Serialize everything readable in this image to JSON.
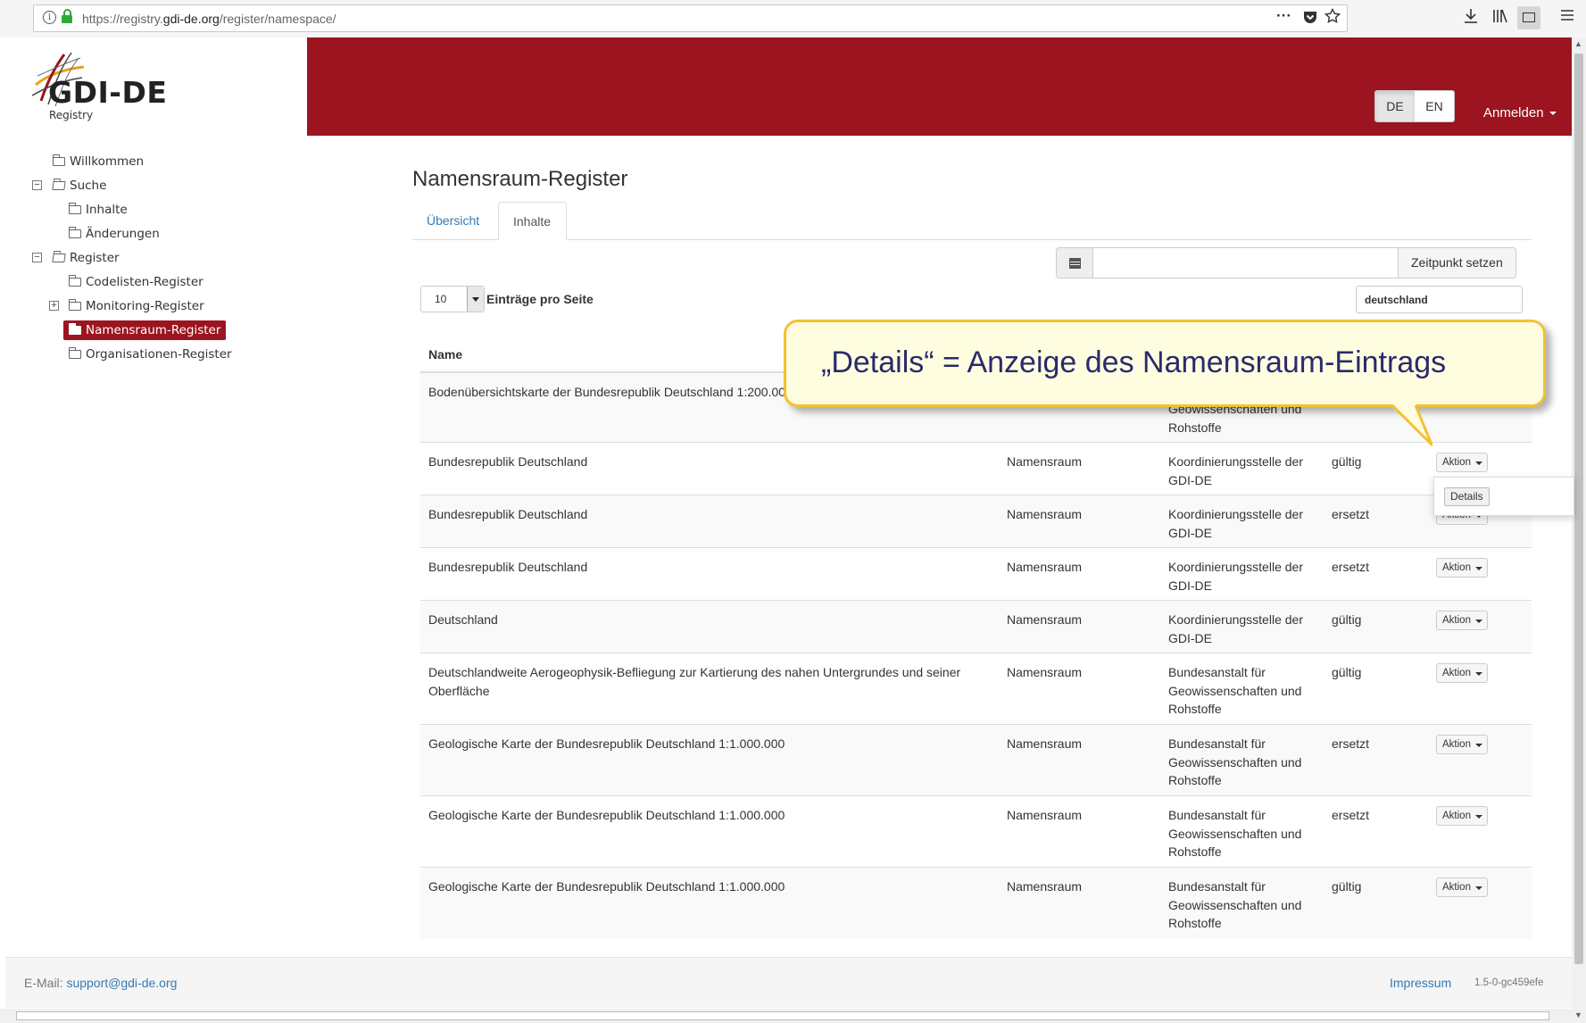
{
  "browser": {
    "url_prefix": "https://registry.",
    "url_domain": "gdi-de.org",
    "url_path": "/register/namespace/",
    "dots": "···"
  },
  "logo": {
    "text": "GDI-DE",
    "sub": "Registry"
  },
  "header": {
    "lang_de": "DE",
    "lang_en": "EN",
    "login": "Anmelden"
  },
  "nav": [
    {
      "label": "Willkommen"
    },
    {
      "label": "Suche"
    },
    {
      "label": "Inhalte"
    },
    {
      "label": "Änderungen"
    },
    {
      "label": "Register"
    },
    {
      "label": "Codelisten-Register"
    },
    {
      "label": "Monitoring-Register"
    },
    {
      "label": "Namensraum-Register"
    },
    {
      "label": "Organisationen-Register"
    }
  ],
  "main": {
    "title": "Namensraum-Register",
    "tabs": [
      "Übersicht",
      "Inhalte"
    ],
    "set_time_label": "Zeitpunkt setzen",
    "page_length": "10",
    "page_length_label": "Einträge pro Seite",
    "search_value": "deutschland",
    "col_name": "Name"
  },
  "rows": [
    {
      "name": "Bodenübersichtskarte der Bundesrepublik Deutschland 1:200.000",
      "type": "",
      "owner": "Geowissenschaften und Rohstoffe",
      "status": "",
      "action": ""
    },
    {
      "name": "Bundesrepublik Deutschland",
      "type": "Namensraum",
      "owner": "Koordinierungsstelle der GDI-DE",
      "status": "gültig",
      "action": "Aktion"
    },
    {
      "name": "Bundesrepublik Deutschland",
      "type": "Namensraum",
      "owner": "Koordinierungsstelle der GDI-DE",
      "status": "ersetzt",
      "action": "Aktion"
    },
    {
      "name": "Bundesrepublik Deutschland",
      "type": "Namensraum",
      "owner": "Koordinierungsstelle der GDI-DE",
      "status": "ersetzt",
      "action": "Aktion"
    },
    {
      "name": "Deutschland",
      "type": "Namensraum",
      "owner": "Koordinierungsstelle der GDI-DE",
      "status": "gültig",
      "action": "Aktion"
    },
    {
      "name": "Deutschlandweite Aerogeophysik-Befliegung zur Kartierung des nahen Untergrundes und seiner Oberfläche",
      "type": "Namensraum",
      "owner": "Bundesanstalt für Geowissenschaften und Rohstoffe",
      "status": "gültig",
      "action": "Aktion"
    },
    {
      "name": "Geologische Karte der Bundesrepublik Deutschland 1:1.000.000",
      "type": "Namensraum",
      "owner": "Bundesanstalt für Geowissenschaften und Rohstoffe",
      "status": "ersetzt",
      "action": "Aktion"
    },
    {
      "name": "Geologische Karte der Bundesrepublik Deutschland 1:1.000.000",
      "type": "Namensraum",
      "owner": "Bundesanstalt für Geowissenschaften und Rohstoffe",
      "status": "ersetzt",
      "action": "Aktion"
    },
    {
      "name": "Geologische Karte der Bundesrepublik Deutschland 1:1.000.000",
      "type": "Namensraum",
      "owner": "Bundesanstalt für Geowissenschaften und Rohstoffe",
      "status": "gültig",
      "action": "Aktion"
    }
  ],
  "dropdown": {
    "details": "Details"
  },
  "callout": {
    "text": "„Details“ = Anzeige des Namensraum-Eintrags"
  },
  "footer": {
    "email_label": "E-Mail: ",
    "email": "support@gdi-de.org",
    "impressum": "Impressum",
    "version": "1.5-0-gc459efe"
  },
  "colors": {
    "brand": "#9b1420",
    "link": "#337ab7",
    "callout_border": "#f4c230",
    "callout_bg": "#fffde0"
  }
}
